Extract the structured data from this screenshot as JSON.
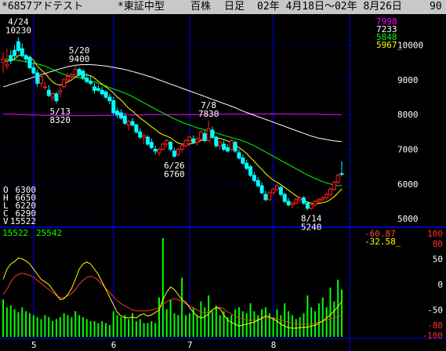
{
  "title_bar": {
    "code_name": "*6857アドテスト",
    "market": "*東証中型",
    "unit": "百株",
    "period": "日足",
    "date_range": "02年 4月18日～02年 8月26日",
    "days": "90"
  },
  "chart_data": {
    "type": "candlestick",
    "price_axis": {
      "ylim": [
        4800,
        10850
      ],
      "ticks": [
        5000,
        6000,
        7000,
        8000,
        9000,
        10000
      ]
    },
    "osc_axis": {
      "ylim": [
        -100,
        100
      ],
      "ticks": [
        "100",
        "80",
        "50",
        "0",
        "-50",
        "-80",
        "-100"
      ]
    },
    "x_tick_labels": [
      {
        "label": "5",
        "day": 8
      },
      {
        "label": "6",
        "day": 29
      },
      {
        "label": "7",
        "day": 49
      },
      {
        "label": "8",
        "day": 71
      }
    ],
    "ma_legend": [
      {
        "value": "7998",
        "color": "#ff00ff"
      },
      {
        "value": "7233",
        "color": "#ffffff"
      },
      {
        "value": "5848",
        "color": "#00ff00"
      },
      {
        "value": "5967_",
        "color": "#ffff00"
      }
    ],
    "ohlcv": {
      "O": "6300",
      "H": "6650",
      "L": "6220",
      "C": "6290",
      "V": "15522"
    },
    "volume_labels": [
      "15522",
      "25542"
    ],
    "osc_labels": [
      {
        "text": "-60.87",
        "color": "#ff4444"
      },
      {
        "text": "-32.58_",
        "color": "#ffff00"
      }
    ],
    "annotations": [
      {
        "date": "4/24",
        "price": "10230",
        "day": 4,
        "y": 10230,
        "pos": "above"
      },
      {
        "date": "5/20",
        "price": "9400",
        "day": 20,
        "y": 9400,
        "pos": "above"
      },
      {
        "date": "5/13",
        "price": "8320",
        "day": 15,
        "y": 8320,
        "pos": "below"
      },
      {
        "date": "7/8",
        "price": "7830",
        "day": 54,
        "y": 7830,
        "pos": "above"
      },
      {
        "date": "6/26",
        "price": "6760",
        "day": 45,
        "y": 6760,
        "pos": "below"
      },
      {
        "date": "8/14",
        "price": "5240",
        "day": 81,
        "y": 5240,
        "pos": "below"
      }
    ],
    "candles": [
      [
        9500,
        9800,
        9200,
        9600
      ],
      [
        9400,
        9900,
        9300,
        9450
      ],
      [
        9700,
        9850,
        9450,
        9550
      ],
      [
        9850,
        10000,
        9600,
        9700
      ],
      [
        10100,
        10230,
        9800,
        9850
      ],
      [
        9900,
        10050,
        9650,
        9700
      ],
      [
        9700,
        9750,
        9500,
        9600
      ],
      [
        9650,
        9700,
        9300,
        9350
      ],
      [
        9350,
        9500,
        9150,
        9200
      ],
      [
        9200,
        9300,
        8800,
        8900
      ],
      [
        8900,
        9200,
        8800,
        9100
      ],
      [
        8800,
        8950,
        8700,
        8800
      ],
      [
        8700,
        8850,
        8500,
        8550
      ],
      [
        8500,
        8650,
        8400,
        8600
      ],
      [
        8600,
        8650,
        8320,
        8400
      ],
      [
        8650,
        8800,
        8500,
        8700
      ],
      [
        8800,
        9050,
        8750,
        9000
      ],
      [
        9000,
        9200,
        8950,
        9100
      ],
      [
        9100,
        9200,
        9000,
        9150
      ],
      [
        9150,
        9400,
        9100,
        9300
      ],
      [
        9300,
        9350,
        9100,
        9150
      ],
      [
        9250,
        9300,
        9000,
        9050
      ],
      [
        9050,
        9200,
        8900,
        8950
      ],
      [
        8950,
        9100,
        8850,
        8900
      ],
      [
        8800,
        8900,
        8600,
        8700
      ],
      [
        8750,
        8850,
        8650,
        8700
      ],
      [
        8700,
        8800,
        8550,
        8600
      ],
      [
        8650,
        8700,
        8450,
        8500
      ],
      [
        8500,
        8600,
        8300,
        8400
      ],
      [
        8400,
        8500,
        8000,
        8050
      ],
      [
        8100,
        8200,
        7900,
        8000
      ],
      [
        8050,
        8150,
        7850,
        7900
      ],
      [
        7950,
        8050,
        7700,
        7750
      ],
      [
        7700,
        7850,
        7550,
        7800
      ],
      [
        7800,
        7900,
        7650,
        7700
      ],
      [
        7700,
        7750,
        7450,
        7500
      ],
      [
        7500,
        7600,
        7300,
        7350
      ],
      [
        7350,
        7450,
        7150,
        7400
      ],
      [
        7350,
        7400,
        7100,
        7150
      ],
      [
        7200,
        7300,
        7000,
        7050
      ],
      [
        7000,
        7100,
        6850,
        6950
      ],
      [
        6900,
        7050,
        6800,
        7000
      ],
      [
        7000,
        7200,
        6950,
        7150
      ],
      [
        7150,
        7300,
        7050,
        7250
      ],
      [
        7200,
        7250,
        6950,
        7000
      ],
      [
        6950,
        7050,
        6760,
        6800
      ],
      [
        6850,
        7050,
        6800,
        7000
      ],
      [
        7000,
        7150,
        6900,
        7100
      ],
      [
        7100,
        7300,
        7050,
        7250
      ],
      [
        7250,
        7400,
        7100,
        7350
      ],
      [
        7300,
        7400,
        7150,
        7200
      ],
      [
        7200,
        7350,
        7100,
        7300
      ],
      [
        7300,
        7550,
        7250,
        7500
      ],
      [
        7450,
        7550,
        7200,
        7250
      ],
      [
        7250,
        7830,
        7200,
        7600
      ],
      [
        7550,
        7650,
        7300,
        7350
      ],
      [
        7350,
        7400,
        7050,
        7100
      ],
      [
        7100,
        7250,
        7000,
        7200
      ],
      [
        7150,
        7250,
        6950,
        7000
      ],
      [
        7050,
        7150,
        6900,
        6950
      ],
      [
        7000,
        7300,
        6950,
        7250
      ],
      [
        7200,
        7250,
        6900,
        6950
      ],
      [
        6900,
        7000,
        6700,
        6750
      ],
      [
        6750,
        6850,
        6550,
        6600
      ],
      [
        6600,
        6700,
        6400,
        6450
      ],
      [
        6500,
        6550,
        6200,
        6250
      ],
      [
        6250,
        6350,
        6050,
        6100
      ],
      [
        6100,
        6200,
        5900,
        5950
      ],
      [
        5950,
        6050,
        5700,
        5750
      ],
      [
        5700,
        5800,
        5500,
        5550
      ],
      [
        5550,
        5800,
        5500,
        5750
      ],
      [
        5750,
        5900,
        5700,
        5850
      ],
      [
        5850,
        6000,
        5800,
        5950
      ],
      [
        5900,
        5950,
        5650,
        5700
      ],
      [
        5700,
        5750,
        5450,
        5500
      ],
      [
        5500,
        5600,
        5350,
        5400
      ],
      [
        5400,
        5500,
        5300,
        5450
      ],
      [
        5450,
        5600,
        5400,
        5550
      ],
      [
        5550,
        5650,
        5450,
        5600
      ],
      [
        5600,
        5650,
        5400,
        5450
      ],
      [
        5450,
        5500,
        5240,
        5300
      ],
      [
        5300,
        5450,
        5250,
        5400
      ],
      [
        5400,
        5550,
        5350,
        5500
      ],
      [
        5500,
        5600,
        5450,
        5550
      ],
      [
        5550,
        5650,
        5500,
        5600
      ],
      [
        5600,
        5750,
        5550,
        5700
      ],
      [
        5700,
        5900,
        5650,
        5850
      ],
      [
        5850,
        6100,
        5800,
        6050
      ],
      [
        6050,
        6300,
        6000,
        6250
      ],
      [
        6300,
        6650,
        6220,
        6290
      ]
    ],
    "ma_short": [
      9560,
      9530,
      9560,
      9600,
      9700,
      9710,
      9680,
      9640,
      9570,
      9390,
      9290,
      9190,
      9060,
      8940,
      8870,
      8850,
      8880,
      8940,
      9000,
      9080,
      9140,
      9160,
      9140,
      9120,
      9050,
      8960,
      8880,
      8800,
      8720,
      8620,
      8510,
      8420,
      8300,
      8180,
      8100,
      8000,
      7900,
      7820,
      7740,
      7650,
      7570,
      7480,
      7420,
      7380,
      7330,
      7250,
      7180,
      7150,
      7140,
      7150,
      7180,
      7200,
      7250,
      7280,
      7330,
      7350,
      7330,
      7310,
      7280,
      7240,
      7180,
      7120,
      7050,
      6970,
      6880,
      6760,
      6650,
      6530,
      6420,
      6300,
      6200,
      6110,
      6050,
      5980,
      5900,
      5820,
      5740,
      5660,
      5590,
      5530,
      5480,
      5450,
      5440,
      5440,
      5460,
      5490,
      5550,
      5630,
      5740,
      5860
    ],
    "ma_mid": [
      9600,
      9590,
      9580,
      9570,
      9560,
      9540,
      9520,
      9500,
      9480,
      9460,
      9430,
      9400,
      9350,
      9300,
      9250,
      9200,
      9160,
      9120,
      9100,
      9080,
      9060,
      9040,
      9000,
      8970,
      8940,
      8900,
      8860,
      8820,
      8780,
      8740,
      8700,
      8660,
      8620,
      8570,
      8520,
      8460,
      8400,
      8340,
      8280,
      8220,
      8160,
      8100,
      8050,
      7990,
      7930,
      7880,
      7830,
      7780,
      7740,
      7700,
      7660,
      7620,
      7590,
      7560,
      7530,
      7500,
      7470,
      7440,
      7400,
      7370,
      7340,
      7310,
      7280,
      7240,
      7200,
      7150,
      7100,
      7040,
      6980,
      6920,
      6860,
      6800,
      6740,
      6680,
      6620,
      6560,
      6500,
      6440,
      6380,
      6320,
      6260,
      6210,
      6160,
      6110,
      6070,
      6030,
      6000,
      5970,
      5950,
      5960
    ],
    "ma_long": [
      8800,
      8830,
      8870,
      8900,
      8940,
      8970,
      9010,
      9040,
      9080,
      9110,
      9150,
      9180,
      9220,
      9250,
      9290,
      9320,
      9350,
      9380,
      9400,
      9420,
      9430,
      9440,
      9440,
      9440,
      9430,
      9420,
      9410,
      9400,
      9380,
      9360,
      9340,
      9320,
      9300,
      9270,
      9240,
      9210,
      9180,
      9150,
      9110,
      9080,
      9040,
      9000,
      8960,
      8920,
      8880,
      8840,
      8800,
      8760,
      8720,
      8680,
      8640,
      8600,
      8560,
      8520,
      8480,
      8440,
      8400,
      8360,
      8320,
      8280,
      8240,
      8200,
      8150,
      8100,
      8060,
      8020,
      7980,
      7940,
      7900,
      7860,
      7820,
      7780,
      7740,
      7700,
      7660,
      7620,
      7580,
      7540,
      7500,
      7460,
      7420,
      7380,
      7350,
      7320,
      7300,
      7280,
      7260,
      7240,
      7233,
      7220
    ],
    "ma_very_long": [
      8010,
      8010,
      8010,
      8010,
      8000,
      8000,
      8000,
      7990,
      7990,
      7990,
      7980,
      7980,
      7980,
      7980,
      7970,
      7970,
      7970,
      7970,
      7970,
      7970,
      7970,
      7970,
      7970,
      7970,
      7970,
      7980,
      7980,
      7980,
      7980,
      7980,
      7980,
      7980,
      7990,
      7990,
      7990,
      7990,
      7990,
      7990,
      8000,
      8000,
      8000,
      8000,
      8000,
      8000,
      8000,
      8000,
      8000,
      8000,
      8000,
      8000,
      8000,
      8000,
      8000,
      8000,
      8000,
      8000,
      8010,
      8010,
      8010,
      8010,
      8010,
      8010,
      8010,
      8010,
      8010,
      8020,
      8020,
      8020,
      8020,
      8020,
      8020,
      8020,
      8020,
      8020,
      8020,
      8020,
      8010,
      8010,
      8010,
      8010,
      8010,
      8010,
      8010,
      8010,
      8000,
      8000,
      8000,
      8000,
      7998,
      7998
    ],
    "volume": [
      38,
      30,
      32,
      28,
      25,
      30,
      26,
      24,
      22,
      20,
      18,
      22,
      20,
      16,
      18,
      20,
      24,
      22,
      20,
      26,
      22,
      20,
      18,
      16,
      16,
      14,
      16,
      14,
      12,
      26,
      22,
      20,
      22,
      18,
      24,
      16,
      18,
      14,
      14,
      16,
      14,
      40,
      100,
      28,
      38,
      24,
      22,
      60,
      22,
      24,
      30,
      22,
      36,
      30,
      42,
      26,
      32,
      22,
      26,
      20,
      22,
      28,
      30,
      26,
      24,
      34,
      26,
      22,
      28,
      30,
      24,
      20,
      28,
      22,
      34,
      26,
      22,
      18,
      20,
      24,
      42,
      30,
      26,
      34,
      40,
      30,
      50,
      36,
      58,
      48
    ],
    "osc_yellow": [
      10,
      30,
      40,
      45,
      52,
      50,
      46,
      40,
      30,
      20,
      10,
      5,
      0,
      -10,
      -20,
      -30,
      -28,
      -20,
      -8,
      10,
      30,
      40,
      44,
      40,
      30,
      20,
      5,
      -10,
      -25,
      -40,
      -55,
      -62,
      -65,
      -66,
      -64,
      -66,
      -60,
      -58,
      -62,
      -60,
      -55,
      -50,
      -30,
      -15,
      -5,
      -10,
      -20,
      -30,
      -35,
      -45,
      -55,
      -62,
      -66,
      -64,
      -58,
      -50,
      -45,
      -48,
      -60,
      -70,
      -75,
      -78,
      -82,
      -80,
      -78,
      -76,
      -74,
      -70,
      -66,
      -62,
      -64,
      -68,
      -72,
      -78,
      -82,
      -85,
      -86,
      -86,
      -85,
      -84,
      -84,
      -82,
      -80,
      -76,
      -72,
      -66,
      -60,
      -52,
      -44,
      -33
    ],
    "osc_red": [
      -20,
      -10,
      5,
      15,
      20,
      22,
      20,
      18,
      14,
      8,
      2,
      -4,
      -10,
      -16,
      -22,
      -26,
      -26,
      -22,
      -18,
      -10,
      0,
      8,
      14,
      16,
      14,
      8,
      0,
      -8,
      -16,
      -24,
      -32,
      -38,
      -42,
      -46,
      -50,
      -52,
      -52,
      -52,
      -52,
      -50,
      -48,
      -46,
      -40,
      -34,
      -30,
      -28,
      -30,
      -34,
      -38,
      -42,
      -46,
      -50,
      -54,
      -56,
      -54,
      -50,
      -46,
      -45,
      -48,
      -54,
      -58,
      -62,
      -66,
      -68,
      -70,
      -70,
      -70,
      -70,
      -68,
      -66,
      -66,
      -66,
      -68,
      -70,
      -72,
      -74,
      -76,
      -78,
      -78,
      -78,
      -78,
      -78,
      -76,
      -74,
      -72,
      -70,
      -68,
      -66,
      -63,
      -60.87
    ]
  }
}
